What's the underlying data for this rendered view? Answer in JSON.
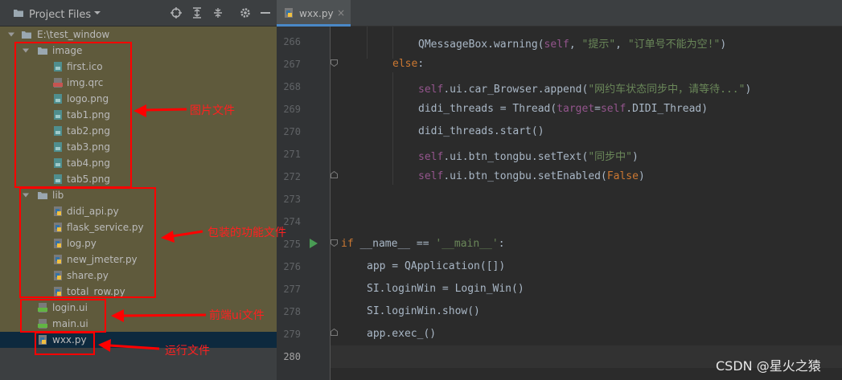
{
  "project_panel": {
    "title": "Project Files",
    "tree": [
      {
        "label": "E:\\test_window",
        "type": "folder"
      },
      {
        "label": "image",
        "type": "folder"
      },
      {
        "label": "first.ico",
        "type": "image"
      },
      {
        "label": "img.qrc",
        "type": "qrc"
      },
      {
        "label": "logo.png",
        "type": "image"
      },
      {
        "label": "tab1.png",
        "type": "image"
      },
      {
        "label": "tab2.png",
        "type": "image"
      },
      {
        "label": "tab3.png",
        "type": "image"
      },
      {
        "label": "tab4.png",
        "type": "image"
      },
      {
        "label": "tab5.png",
        "type": "image"
      },
      {
        "label": "lib",
        "type": "folder"
      },
      {
        "label": "didi_api.py",
        "type": "python"
      },
      {
        "label": "flask_service.py",
        "type": "python"
      },
      {
        "label": "log.py",
        "type": "python"
      },
      {
        "label": "new_jmeter.py",
        "type": "python"
      },
      {
        "label": "share.py",
        "type": "python"
      },
      {
        "label": "total_row.py",
        "type": "python"
      },
      {
        "label": "login.ui",
        "type": "ui"
      },
      {
        "label": "main.ui",
        "type": "ui"
      },
      {
        "label": "wxx.py",
        "type": "python"
      }
    ]
  },
  "editor": {
    "tab": "wxx.py",
    "current_line": "280",
    "line_numbers": [
      "266",
      "267",
      "268",
      "269",
      "270",
      "271",
      "272",
      "273",
      "274",
      "275",
      "276",
      "277",
      "278",
      "279",
      "280"
    ]
  },
  "annotations": {
    "images": "图片文件",
    "lib": "包装的功能文件",
    "ui": "前端ui文件",
    "run": "运行文件"
  },
  "watermark": "CSDN @星火之猿",
  "colors": {
    "annotation": "#ff0000",
    "panel_bg": "#3c3f41",
    "editor_bg": "#2b2b2b",
    "selection": "#0d293e"
  }
}
